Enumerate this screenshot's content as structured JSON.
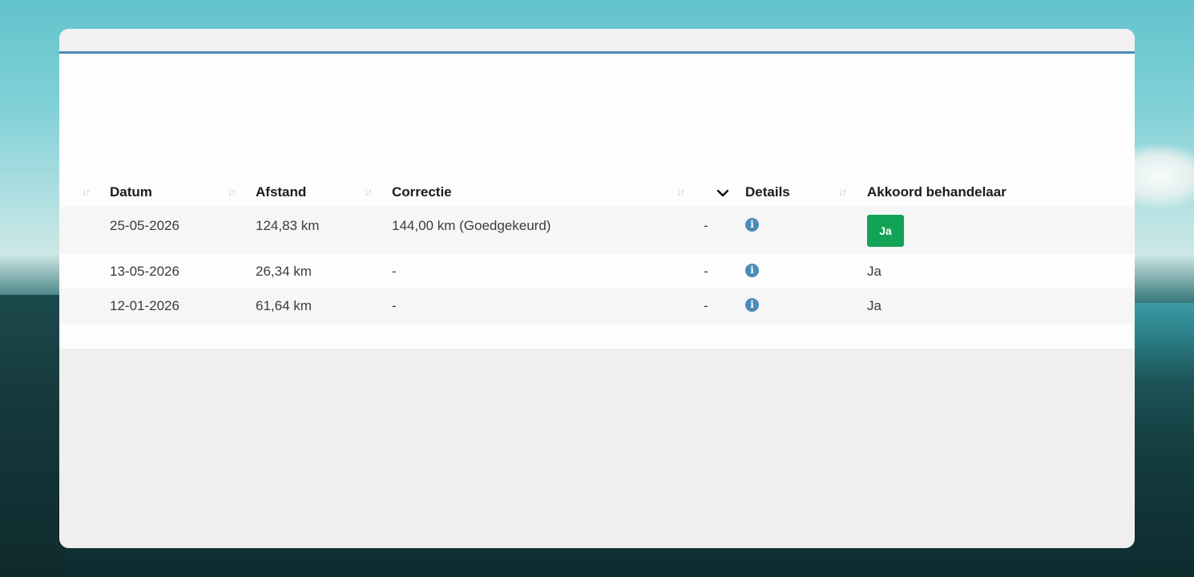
{
  "table": {
    "headers": {
      "datum": "Datum",
      "afstand": "Afstand",
      "correctie": "Correctie",
      "details": "Details",
      "akkoord": "Akkoord behandelaar"
    },
    "sort_icon": "sort-icon",
    "expand_icon": "chevron-down-icon",
    "info_icon": "info-icon",
    "rows": [
      {
        "datum": "25-05-2026",
        "afstand": "124,83 km",
        "correctie": "144,00 km (Goedgekeurd)",
        "extra": "-",
        "akkoord": "Ja",
        "akkoord_is_button": true
      },
      {
        "datum": "13-05-2026",
        "afstand": "26,34 km",
        "correctie": "-",
        "extra": "-",
        "akkoord": "Ja",
        "akkoord_is_button": false
      },
      {
        "datum": "12-01-2026",
        "afstand": "61,64 km",
        "correctie": "-",
        "extra": "-",
        "akkoord": "Ja",
        "akkoord_is_button": false
      }
    ]
  },
  "colors": {
    "accent": "#4a8bb5",
    "approve_button": "#13a356",
    "card_background": "#efefef"
  }
}
